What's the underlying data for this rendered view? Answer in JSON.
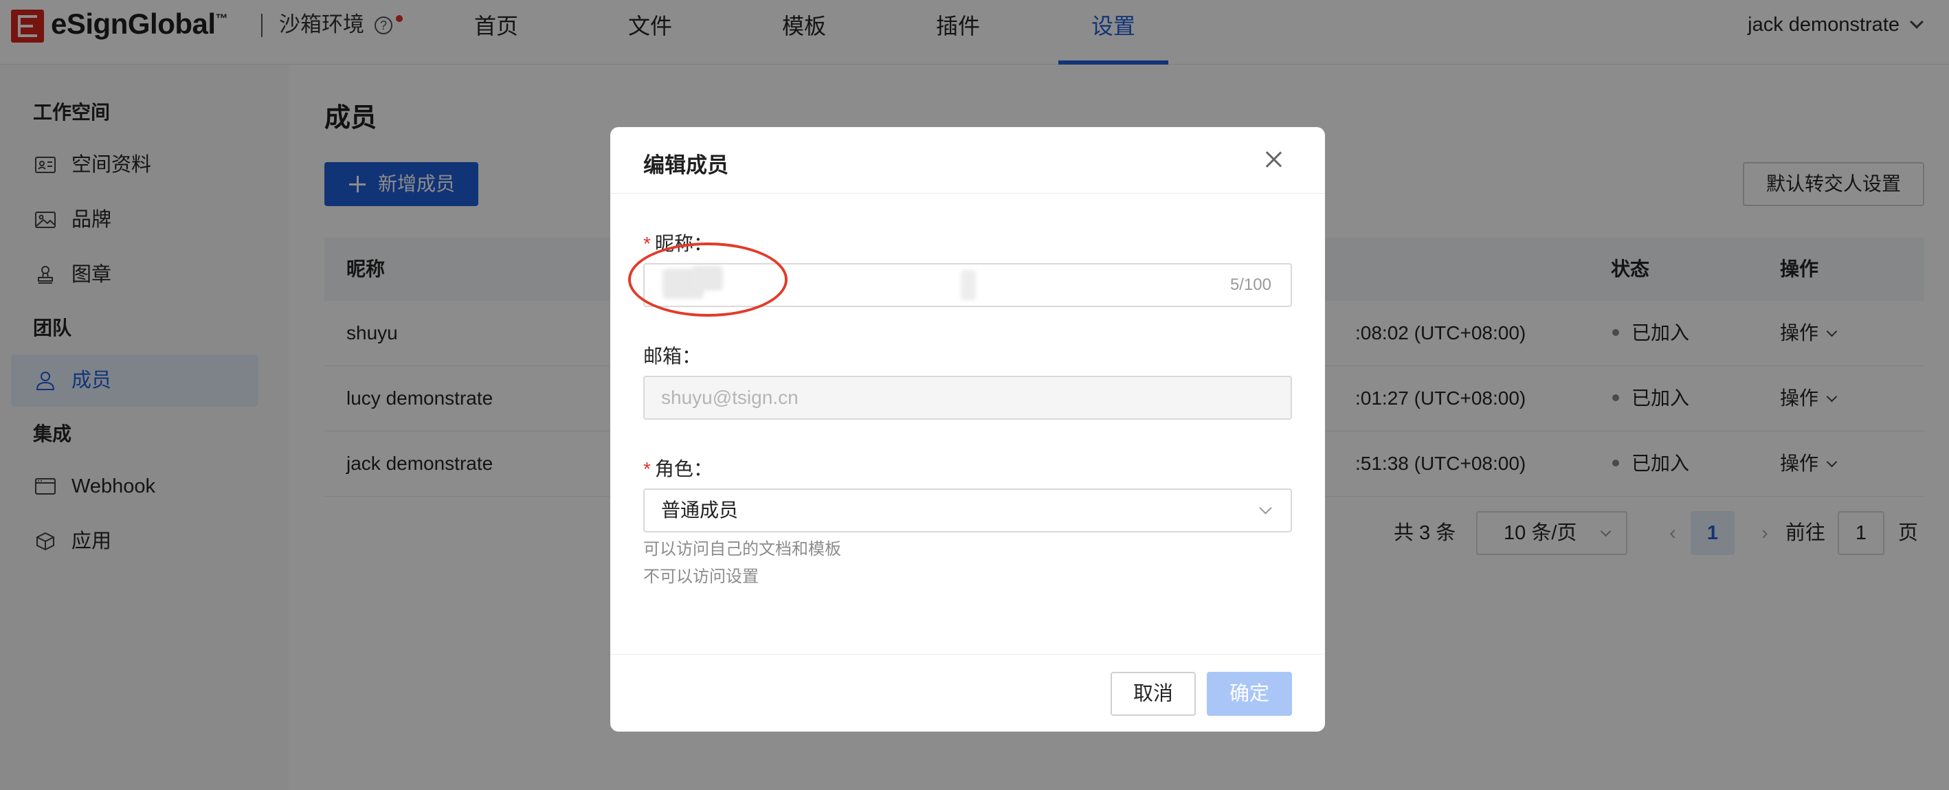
{
  "brand": {
    "name": "eSignGlobal",
    "trademark": "™",
    "environment": "沙箱环境",
    "help_symbol": "?"
  },
  "nav": {
    "items": [
      {
        "label": "首页"
      },
      {
        "label": "文件"
      },
      {
        "label": "模板"
      },
      {
        "label": "插件"
      },
      {
        "label": "设置",
        "active": true
      }
    ],
    "user_name": "jack demonstrate"
  },
  "sidebar": {
    "groups": [
      {
        "title": "工作空间",
        "items": [
          {
            "label": "空间资料",
            "icon": "id-card-icon"
          },
          {
            "label": "品牌",
            "icon": "image-icon"
          },
          {
            "label": "图章",
            "icon": "stamp-icon"
          }
        ]
      },
      {
        "title": "团队",
        "items": [
          {
            "label": "成员",
            "icon": "user-icon",
            "active": true
          }
        ]
      },
      {
        "title": "集成",
        "items": [
          {
            "label": "Webhook",
            "icon": "browser-window-icon"
          },
          {
            "label": "应用",
            "icon": "cube-icon"
          }
        ]
      }
    ]
  },
  "main": {
    "title": "成员",
    "add_button": "新增成员",
    "transfer_button": "默认转交人设置",
    "table": {
      "columns": {
        "nickname": "昵称",
        "status": "状态",
        "actions": "操作"
      },
      "rows": [
        {
          "nickname": "shuyu",
          "time": ":08:02 (UTC+08:00)",
          "status": "已加入",
          "action": "操作"
        },
        {
          "nickname": "lucy demonstrate",
          "time": ":01:27 (UTC+08:00)",
          "status": "已加入",
          "action": "操作"
        },
        {
          "nickname": "jack demonstrate",
          "time": ":51:38 (UTC+08:00)",
          "status": "已加入",
          "action": "操作"
        }
      ]
    },
    "pagination": {
      "total": "共 3 条",
      "page_size": "10 条/页",
      "prev": "‹",
      "current": "1",
      "next": "›",
      "goto_label": "前往",
      "goto_value": "1",
      "page_suffix": "页"
    }
  },
  "modal": {
    "title": "编辑成员",
    "nickname_label": "昵称：",
    "nickname_counter": "5/100",
    "email_label": "邮箱：",
    "email_value": "shuyu@tsign.cn",
    "role_label": "角色：",
    "role_value": "普通成员",
    "role_hint_1": "可以访问自己的文档和模板",
    "role_hint_2": "不可以访问设置",
    "cancel": "取消",
    "ok": "确定"
  },
  "colors": {
    "primary": "#1f5fd8",
    "required": "#e0312b",
    "annotation": "#e23b2a",
    "ok_disabled": "#a9c6f7"
  }
}
